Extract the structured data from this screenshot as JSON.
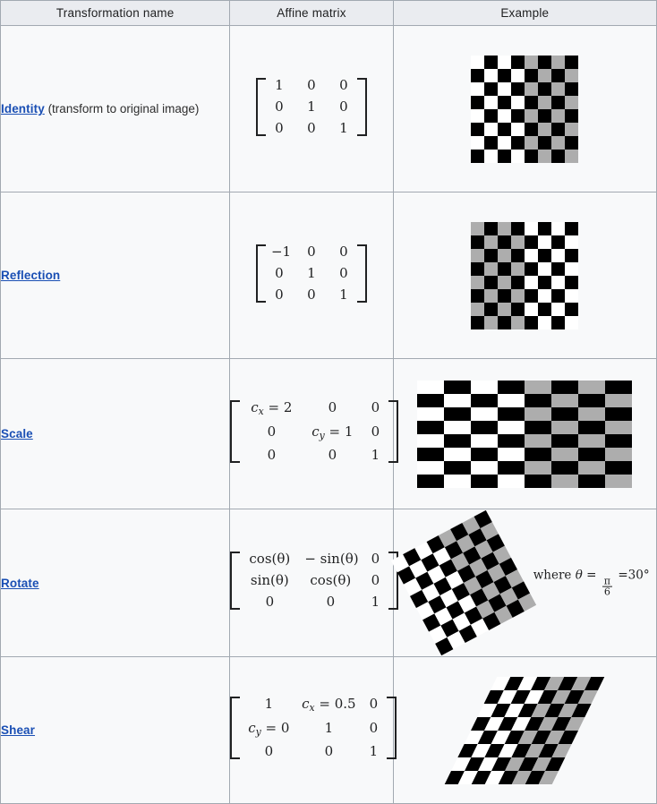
{
  "table": {
    "headers": [
      "Transformation name",
      "Affine matrix",
      "Example"
    ],
    "rows": [
      {
        "id": "identity",
        "link_label": "Identity",
        "name_suffix": " (transform to original image)",
        "matrix": {
          "rows": [
            [
              "1",
              "0",
              "0"
            ],
            [
              "0",
              "1",
              "0"
            ],
            [
              "0",
              "0",
              "1"
            ]
          ]
        },
        "example": {
          "kind": "checkerboard",
          "transform": "none",
          "cols": 8,
          "rows": 8,
          "left_light": "#ffffff",
          "right_light": "#adadad",
          "dark": "#000000"
        }
      },
      {
        "id": "reflection",
        "link_label": "Reflection",
        "name_suffix": "",
        "matrix": {
          "rows": [
            [
              "−1",
              "0",
              "0"
            ],
            [
              "0",
              "1",
              "0"
            ],
            [
              "0",
              "0",
              "1"
            ]
          ]
        },
        "example": {
          "kind": "checkerboard",
          "transform": "mirror-horizontal",
          "cols": 8,
          "rows": 8,
          "left_light": "#adadad",
          "right_light": "#ffffff",
          "dark": "#000000"
        }
      },
      {
        "id": "scale",
        "link_label": "Scale",
        "name_suffix": "",
        "matrix": {
          "rows": [
            [
              "c_x = 2",
              "0",
              "0"
            ],
            [
              "0",
              "c_y = 1",
              "0"
            ],
            [
              "0",
              "0",
              "1"
            ]
          ],
          "cx_label": "c",
          "cx_sub": "x",
          "cx_value": "2",
          "cy_label": "c",
          "cy_sub": "y",
          "cy_value": "1"
        },
        "example": {
          "kind": "checkerboard",
          "transform": "scale-x-2",
          "cols": 8,
          "rows": 8,
          "left_light": "#ffffff",
          "right_light": "#adadad",
          "dark": "#000000"
        }
      },
      {
        "id": "rotate",
        "link_label": "Rotate",
        "name_suffix": "",
        "matrix": {
          "rows": [
            [
              "cos(θ)",
              "− sin(θ)",
              "0"
            ],
            [
              "sin(θ)",
              "cos(θ)",
              "0"
            ],
            [
              "0",
              "0",
              "1"
            ]
          ]
        },
        "example": {
          "kind": "checkerboard",
          "transform": "rotate",
          "angle_deg": 30,
          "cols": 8,
          "rows": 8,
          "left_light": "#ffffff",
          "right_light": "#adadad",
          "dark": "#000000"
        },
        "note": {
          "prefix": "where ",
          "theta": "θ",
          "equals": " = ",
          "frac_num": "π",
          "frac_den": "6",
          "result": " =30°"
        }
      },
      {
        "id": "shear",
        "link_label": "Shear",
        "name_suffix": "",
        "matrix": {
          "rows": [
            [
              "1",
              "c_x = 0.5",
              "0"
            ],
            [
              "c_y = 0",
              "1",
              "0"
            ],
            [
              "0",
              "0",
              "1"
            ]
          ],
          "cx_label": "c",
          "cx_sub": "x",
          "cx_value": "0.5",
          "cy_label": "c",
          "cy_sub": "y",
          "cy_value": "0"
        },
        "example": {
          "kind": "checkerboard",
          "transform": "skew-x",
          "angle_deg": -26,
          "cols": 8,
          "rows": 8,
          "left_light": "#ffffff",
          "right_light": "#adadad",
          "dark": "#000000"
        }
      }
    ]
  },
  "symbols": {
    "equals": "=",
    "minus": "−",
    "theta": "θ",
    "pi": "π",
    "degree": "°"
  },
  "colors": {
    "link": "#1a4fb4",
    "text": "#202122",
    "border": "#a2a9b1",
    "header_bg": "#eaecf0",
    "cell_bg": "#f8f9fa",
    "checker_gray": "#adadad",
    "checker_black": "#000000",
    "checker_white": "#ffffff"
  }
}
